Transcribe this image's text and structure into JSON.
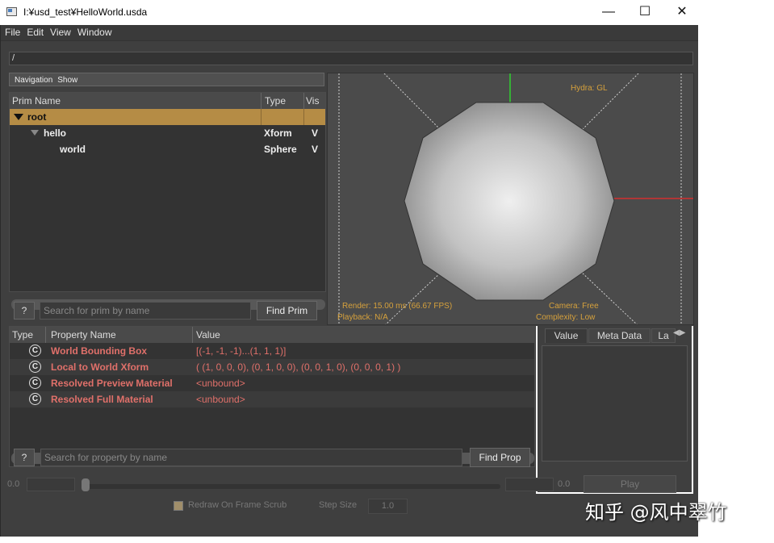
{
  "window": {
    "title": "I:¥usd_test¥HelloWorld.usda",
    "minimize": "—",
    "maximize": "☐",
    "close": "✕"
  },
  "menu": [
    "File",
    "Edit",
    "View",
    "Window"
  ],
  "path": "/",
  "nav": {
    "navigation": "Navigation",
    "show": "Show"
  },
  "tree": {
    "headers": {
      "name": "Prim Name",
      "type": "Type",
      "vis": "Vis"
    },
    "rows": [
      {
        "name": "root",
        "type": "",
        "vis": ""
      },
      {
        "name": "hello",
        "type": "Xform",
        "vis": "V"
      },
      {
        "name": "world",
        "type": "Sphere",
        "vis": "V"
      }
    ]
  },
  "prim_search": {
    "help": "?",
    "placeholder": "Search for prim by name",
    "button": "Find Prim"
  },
  "viewport": {
    "hydra": "Hydra: GL",
    "render": "Render: 15.00 ms (66.67 FPS)",
    "playback": "Playback: N/A",
    "camera": "Camera: Free",
    "complexity": "Complexity: Low"
  },
  "props": {
    "headers": {
      "type": "Type",
      "name": "Property Name",
      "value": "Value"
    },
    "rows": [
      {
        "icon": "C",
        "name": "World Bounding Box",
        "value": "[(-1, -1, -1)...(1, 1, 1)]"
      },
      {
        "icon": "C",
        "name": "Local to World Xform",
        "value": "( (1, 0, 0, 0), (0, 1, 0, 0), (0, 0, 1, 0), (0, 0, 0, 1) )"
      },
      {
        "icon": "C",
        "name": "Resolved Preview Material",
        "value": "<unbound>"
      },
      {
        "icon": "C",
        "name": "Resolved Full Material",
        "value": "<unbound>"
      }
    ]
  },
  "prop_search": {
    "help": "?",
    "placeholder": "Search for property by name",
    "button": "Find Prop"
  },
  "meta_tabs": [
    "Value",
    "Meta Data",
    "La"
  ],
  "timeline": {
    "start": "0.0",
    "end": "0.0",
    "play": "Play",
    "redraw": "Redraw On Frame Scrub",
    "step_label": "Step Size",
    "step_value": "1.0"
  },
  "watermark": "知乎 @风中翠竹"
}
